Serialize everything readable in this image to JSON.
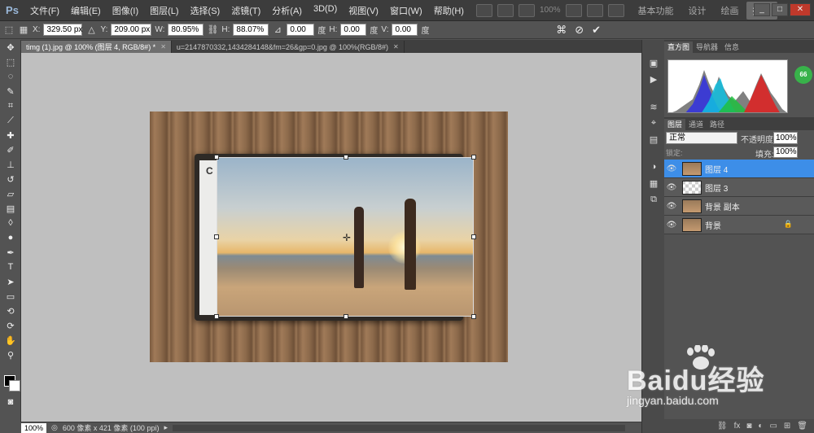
{
  "app": {
    "logo": "Ps"
  },
  "menu": [
    "文件(F)",
    "编辑(E)",
    "图像(I)",
    "图层(L)",
    "选择(S)",
    "滤镜(T)",
    "分析(A)",
    "3D(D)",
    "视图(V)",
    "窗口(W)",
    "帮助(H)"
  ],
  "menubar_zoom": "100%",
  "workspaces": [
    "基本功能",
    "设计",
    "绘画",
    "摄影"
  ],
  "workspace_active_index": 3,
  "options": {
    "x_label": "X:",
    "x_value": "329.50 px",
    "y_label": "Y:",
    "y_value": "209.00 px",
    "w_label": "W:",
    "w_value": "80.95%",
    "h_label": "H:",
    "h_value": "88.07%",
    "angle_value": "0.00",
    "angle_unit": "度",
    "hskew_label": "H:",
    "hskew_value": "0.00",
    "hskew_unit": "度",
    "vskew_label": "V:",
    "vskew_value": "0.00",
    "vskew_unit": "度"
  },
  "tabs": [
    {
      "label": "timg (1).jpg @ 100% (图层 4, RGB/8#) *",
      "active": true
    },
    {
      "label": "u=2147870332,1434284148&fm=26&gp=0.jpg @ 100%(RGB/8#)",
      "active": false
    }
  ],
  "status": {
    "zoom": "100%",
    "doc_info": "600 像素 x 421 像素 (100 ppi)"
  },
  "panels": {
    "top_tabs": [
      "直方图",
      "导航器",
      "信息"
    ],
    "badge": "66",
    "layers_tabs": [
      "图层",
      "通道",
      "路径"
    ],
    "blend_mode": "正常",
    "opacity_label": "不透明度:",
    "opacity_value": "100%",
    "lock_label": "锁定:",
    "fill_label": "填充:",
    "fill_value": "100%"
  },
  "layers": [
    {
      "name": "图层 4",
      "selected": true,
      "thumb": "photo"
    },
    {
      "name": "图层 3",
      "selected": false,
      "thumb": "checker"
    },
    {
      "name": "背景 副本",
      "selected": false,
      "thumb": "wood"
    },
    {
      "name": "背景",
      "selected": false,
      "thumb": "wood",
      "locked": true
    }
  ],
  "watermark": {
    "main": "Baidu经验",
    "sub": "jingyan.baidu.com"
  }
}
